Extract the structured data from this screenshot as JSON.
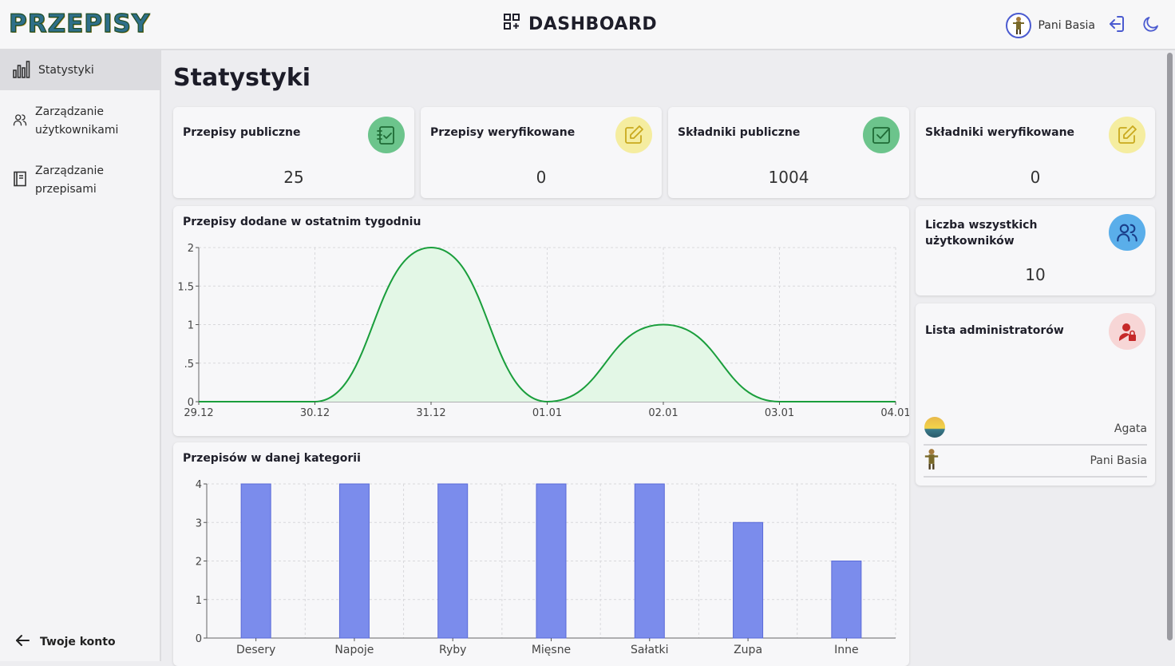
{
  "header": {
    "logo": "PRZEPISY",
    "title": "DASHBOARD",
    "user_name": "Pani Basia"
  },
  "sidebar": {
    "items": [
      {
        "label": "Statystyki",
        "icon": "bar-chart-icon",
        "active": true
      },
      {
        "label": "Zarządzanie użytkownikami",
        "icon": "users-icon",
        "active": false
      },
      {
        "label": "Zarządzanie przepisami",
        "icon": "book-icon",
        "active": false
      }
    ],
    "footer_label": "Twoje konto"
  },
  "main": {
    "page_title": "Statystyki",
    "stats": [
      {
        "label": "Przepisy publiczne",
        "value": "25",
        "icon": "checklist-icon",
        "color": "#6cc48c"
      },
      {
        "label": "Przepisy weryfikowane",
        "value": "0",
        "icon": "edit-icon",
        "color": "#f5eda0"
      },
      {
        "label": "Składniki publiczne",
        "value": "1004",
        "icon": "check-square-icon",
        "color": "#6cc48c"
      },
      {
        "label": "Składniki weryfikowane",
        "value": "0",
        "icon": "edit-icon",
        "color": "#f5eda0"
      }
    ],
    "users_card": {
      "label": "Liczba wszystkich użytkowników",
      "value": "10",
      "icon": "users-icon",
      "color": "#5aaeea"
    },
    "admins_card": {
      "label": "Lista administratorów",
      "icon": "admin-lock-icon",
      "color": "#f7d6d6",
      "admins": [
        "Agata",
        "Pani Basia"
      ]
    }
  },
  "chart_data": [
    {
      "type": "area",
      "title": "Przepisy dodane w ostatnim tygodniu",
      "categories": [
        "29.12",
        "30.12",
        "31.12",
        "01.01",
        "02.01",
        "03.01",
        "04.01"
      ],
      "values": [
        0,
        0,
        2,
        0,
        1,
        0,
        0
      ],
      "yticks": [
        "0",
        ".5",
        "1",
        "1.5",
        "2"
      ],
      "ylim": [
        0,
        2
      ],
      "color": "#1a9e3c",
      "fill": "#e3f7e6",
      "grid": true
    },
    {
      "type": "bar",
      "title": "Przepisów w danej kategorii",
      "categories": [
        "Desery",
        "Napoje",
        "Ryby",
        "Mięsne",
        "Sałatki",
        "Zupa",
        "Inne"
      ],
      "values": [
        4,
        4,
        4,
        4,
        4,
        3,
        2
      ],
      "yticks": [
        "0",
        "1",
        "2",
        "3",
        "4"
      ],
      "ylim": [
        0,
        4
      ],
      "color": "#7b8cec",
      "grid": true
    }
  ]
}
